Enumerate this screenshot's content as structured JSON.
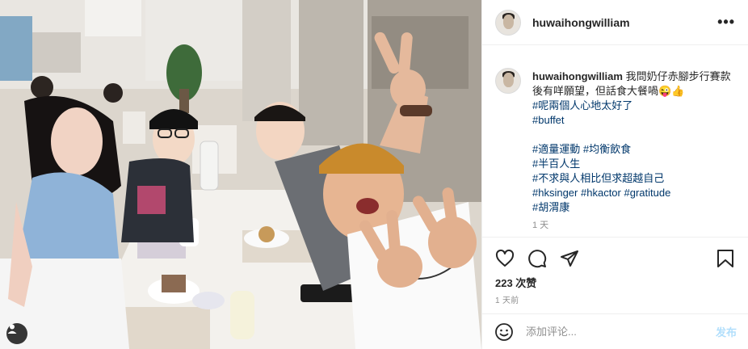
{
  "post": {
    "username": "huwaihongwilliam",
    "more_label": "•••",
    "photo_alt": "",
    "caption": {
      "username": "huwaihongwilliam",
      "text": "我問奶仔赤腳步行賽款後有咩願望，但話食大餐喎😜👍",
      "tags_block1": [
        "#呢兩個人心地太好了",
        "#buffet"
      ],
      "tags_line1": [
        "#適量運動",
        "#均衡飲食"
      ],
      "tags_line2": "#半百人生",
      "tags_line3": "#不求與人相比但求超越自己",
      "tags_line4": [
        "#hksinger",
        "#hkactor",
        "#gratitude"
      ],
      "tags_line5": "#胡渭康",
      "time": "1 天"
    },
    "likes": "223 次赞",
    "date": "1 天前",
    "comment": {
      "placeholder": "添加评论...",
      "post_label": "发布"
    }
  },
  "icons": {
    "like": "heart-icon",
    "comment": "comment-bubble-icon",
    "share": "paper-plane-icon",
    "save": "bookmark-icon",
    "emoji": "smiley-icon",
    "user_tag": "person-icon"
  },
  "colors": {
    "link": "#00376b",
    "secondary_text": "#8e8e8e",
    "post_button_disabled": "#b2dffc",
    "border": "#efefef"
  }
}
